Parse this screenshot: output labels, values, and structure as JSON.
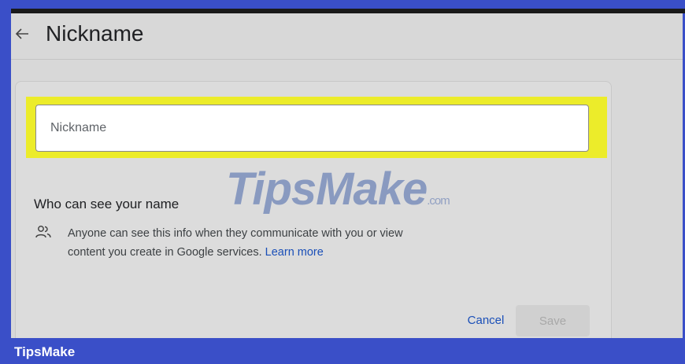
{
  "header": {
    "title": "Nickname"
  },
  "nickname_field": {
    "placeholder": "Nickname",
    "value": ""
  },
  "visibility": {
    "title": "Who can see your name",
    "description": "Anyone can see this info when they communicate with you or view content you create in Google services.",
    "link_label": "Learn more"
  },
  "actions": {
    "cancel_label": "Cancel",
    "save_label": "Save"
  },
  "watermark": {
    "main": "TipsMake",
    "suffix": ".com"
  },
  "footer": {
    "brand": "TipsMake"
  },
  "colors": {
    "accent": "#1a4fb8",
    "highlight": "#ecec2a",
    "frame": "#3a4fc8"
  }
}
